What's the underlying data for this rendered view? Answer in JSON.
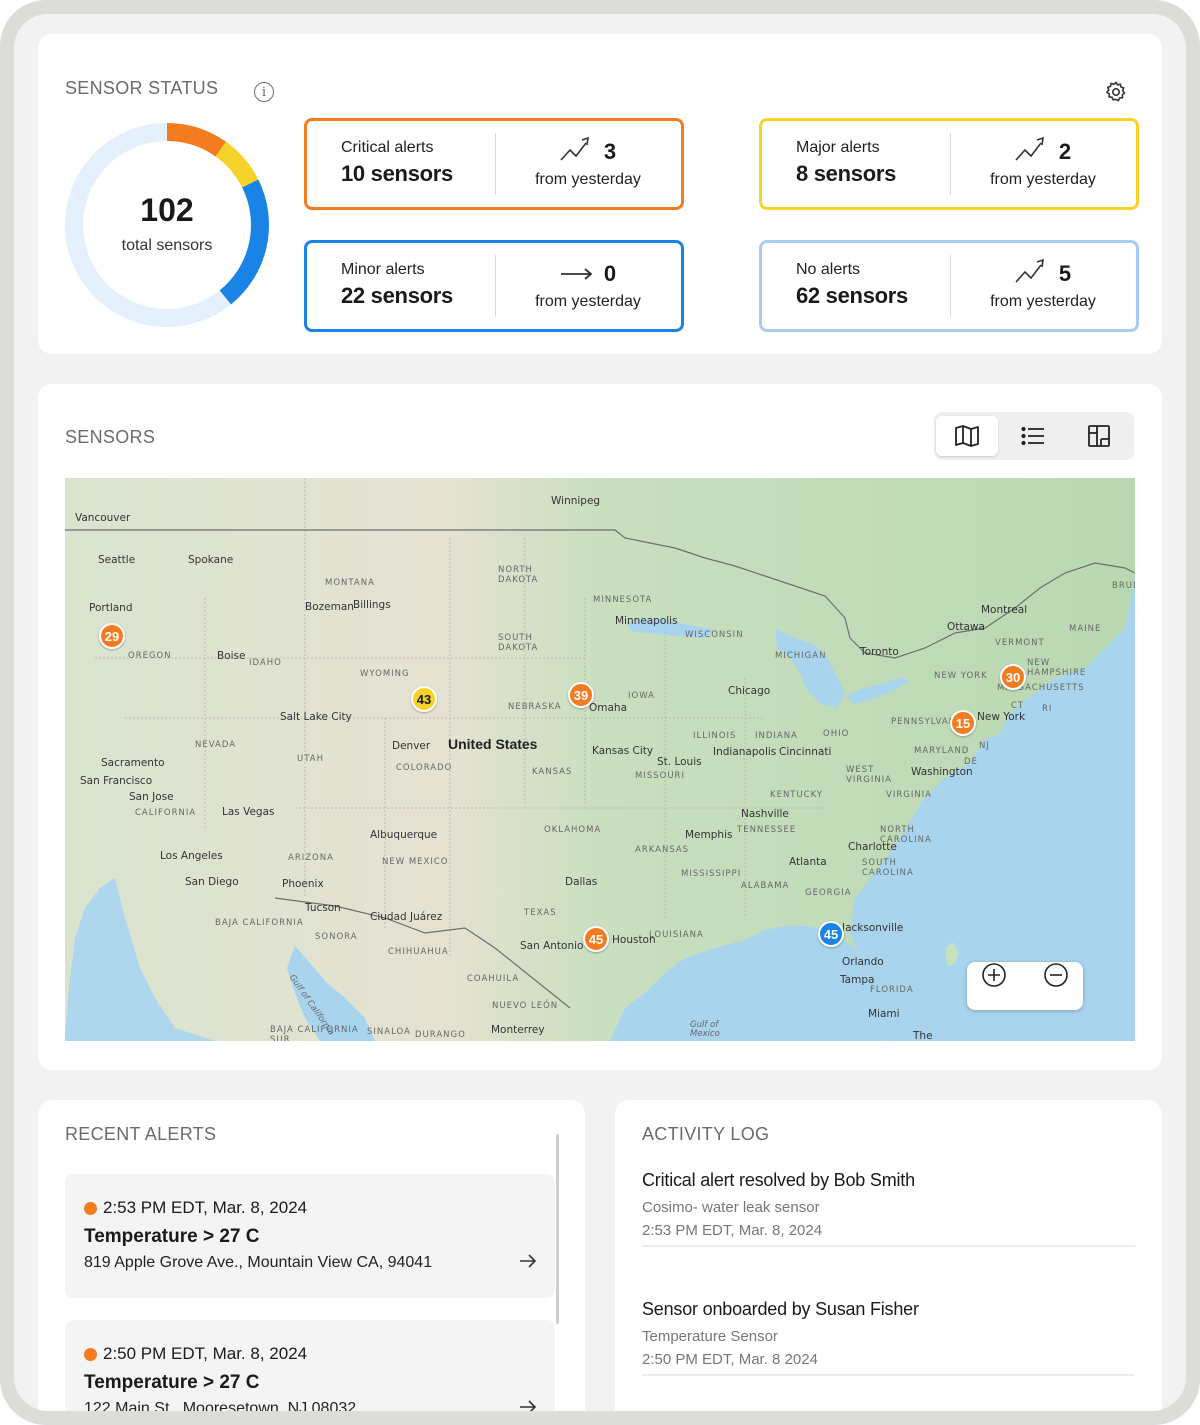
{
  "sensor_status": {
    "title": "SENSOR STATUS",
    "total_value": "102",
    "total_label": "total sensors",
    "donut_segments": [
      {
        "name": "critical",
        "value": 10,
        "color": "#f47b20"
      },
      {
        "name": "major",
        "value": 8,
        "color": "#f6d32a"
      },
      {
        "name": "minor",
        "value": 22,
        "color": "#1a84e6"
      },
      {
        "name": "none",
        "value": 62,
        "color": "#e4f1fc"
      }
    ],
    "boxes": [
      {
        "label": "Critical alerts",
        "count": "10 sensors",
        "trend_value": "3",
        "trend_text": "from yesterday",
        "trend_icon": "trending-up-icon",
        "border": "#f47b20"
      },
      {
        "label": "Major alerts",
        "count": "8 sensors",
        "trend_value": "2",
        "trend_text": "from yesterday",
        "trend_icon": "trending-up-icon",
        "border": "#f6d32a"
      },
      {
        "label": "Minor alerts",
        "count": "22 sensors",
        "trend_value": "0",
        "trend_text": "from yesterday",
        "trend_icon": "arrow-right-icon",
        "border": "#1a84e6"
      },
      {
        "label": "No alerts",
        "count": "62 sensors",
        "trend_value": "5",
        "trend_text": "from yesterday",
        "trend_icon": "trending-up-icon",
        "border": "#a9cdf0"
      }
    ]
  },
  "sensors": {
    "title": "SENSORS",
    "views": [
      "map-icon",
      "list-icon",
      "layout-icon"
    ],
    "active_view": "map-icon",
    "map": {
      "country_label": "United States",
      "cities": [
        "Vancouver",
        "Seattle",
        "Spokane",
        "Portland",
        "Winnipeg",
        "Boise",
        "Billings",
        "Bozeman",
        "Salt Lake City",
        "Sacramento",
        "San Francisco",
        "San Jose",
        "Las Vegas",
        "Los Angeles",
        "San Diego",
        "Phoenix",
        "Tucson",
        "Albuquerque",
        "Denver",
        "Minneapolis",
        "Omaha",
        "Kansas City",
        "St. Louis",
        "Chicago",
        "Indianapolis",
        "Cincinnati",
        "Toronto",
        "Ottawa",
        "Montreal",
        "Nashville",
        "Memphis",
        "Dallas",
        "San Antonio",
        "Houston",
        "Atlanta",
        "Charlotte",
        "Washington",
        "New York",
        "Jacksonville",
        "Orlando",
        "Tampa",
        "Miami",
        "Monterrey",
        "Ciudad Juárez",
        "The"
      ],
      "states": [
        "MONTANA",
        "NORTH DAKOTA",
        "SOUTH DAKOTA",
        "MINNESOTA",
        "WISCONSIN",
        "MICHIGAN",
        "IOWA",
        "NEBRASKA",
        "WYOMING",
        "IDAHO",
        "OREGON",
        "NEVADA",
        "UTAH",
        "COLORADO",
        "KANSAS",
        "MISSOURI",
        "ILLINOIS",
        "INDIANA",
        "OHIO",
        "PENNSYLVANIA",
        "NEW YORK",
        "VERMONT",
        "MAINE",
        "NEW HAMPSHIRE",
        "MASSACHUSETTS",
        "CT",
        "RI",
        "NJ",
        "MARYLAND",
        "DE",
        "WEST VIRGINIA",
        "VIRGINIA",
        "KENTUCKY",
        "TENNESSEE",
        "NORTH CAROLINA",
        "SOUTH CAROLINA",
        "GEORGIA",
        "ALABAMA",
        "MISSISSIPPI",
        "ARKANSAS",
        "LOUISIANA",
        "OKLAHOMA",
        "TEXAS",
        "NEW MEXICO",
        "ARIZONA",
        "CALIFORNIA",
        "BAJA CALIFORNIA",
        "SONORA",
        "CHIHUAHUA",
        "COAHUILA",
        "NUEVO LEÓN",
        "SINALOA",
        "DURANGO",
        "BAJA CALIFORNIA SUR",
        "FLORIDA",
        "Gulf of California",
        "Gulf of Mexico",
        "BRUN"
      ],
      "pins": [
        {
          "value": "29",
          "color": "#f47b20"
        },
        {
          "value": "43",
          "color": "#f6d32a"
        },
        {
          "value": "39",
          "color": "#f47b20"
        },
        {
          "value": "30",
          "color": "#f47b20"
        },
        {
          "value": "15",
          "color": "#f47b20"
        },
        {
          "value": "45",
          "color": "#f47b20"
        },
        {
          "value": "45",
          "color": "#1a84e6"
        }
      ],
      "zoom_in_icon": "zoom-in-icon",
      "zoom_out_icon": "zoom-out-icon"
    }
  },
  "recent_alerts": {
    "title": "RECENT ALERTS",
    "items": [
      {
        "time": "2:53 PM EDT, Mar. 8, 2024",
        "metric": "Temperature > 27 C",
        "address": "819 Apple Grove Ave., Mountain View CA, 94041"
      },
      {
        "time": "2:50 PM EDT, Mar. 8, 2024",
        "metric": "Temperature > 27 C",
        "address": "122 Main St., Mooresetown, NJ 08032"
      }
    ]
  },
  "activity_log": {
    "title": "ACTIVITY LOG",
    "items": [
      {
        "headline": "Critical alert resolved by Bob Smith",
        "detail": "Cosimo- water leak sensor",
        "time": "2:53 PM EDT, Mar. 8, 2024"
      },
      {
        "headline": "Sensor onboarded by Susan Fisher",
        "detail": "Temperature Sensor",
        "time": "2:50 PM EDT, Mar. 8 2024"
      }
    ]
  }
}
